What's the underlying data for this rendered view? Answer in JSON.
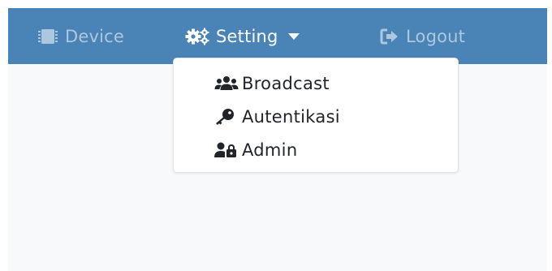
{
  "navbar": {
    "items": [
      {
        "label": "Device",
        "icon": "microchip-icon"
      },
      {
        "label": "Setting",
        "icon": "cogs-icon"
      },
      {
        "label": "Logout",
        "icon": "sign-out-icon"
      }
    ]
  },
  "dropdown": {
    "items": [
      {
        "label": "Broadcast",
        "icon": "users-icon"
      },
      {
        "label": "Autentikasi",
        "icon": "key-icon"
      },
      {
        "label": "Admin",
        "icon": "user-lock-icon"
      }
    ]
  },
  "colors": {
    "navbar_bg": "#4a83b6",
    "page_bg": "#f8f9fa",
    "text_dark": "#212529"
  }
}
